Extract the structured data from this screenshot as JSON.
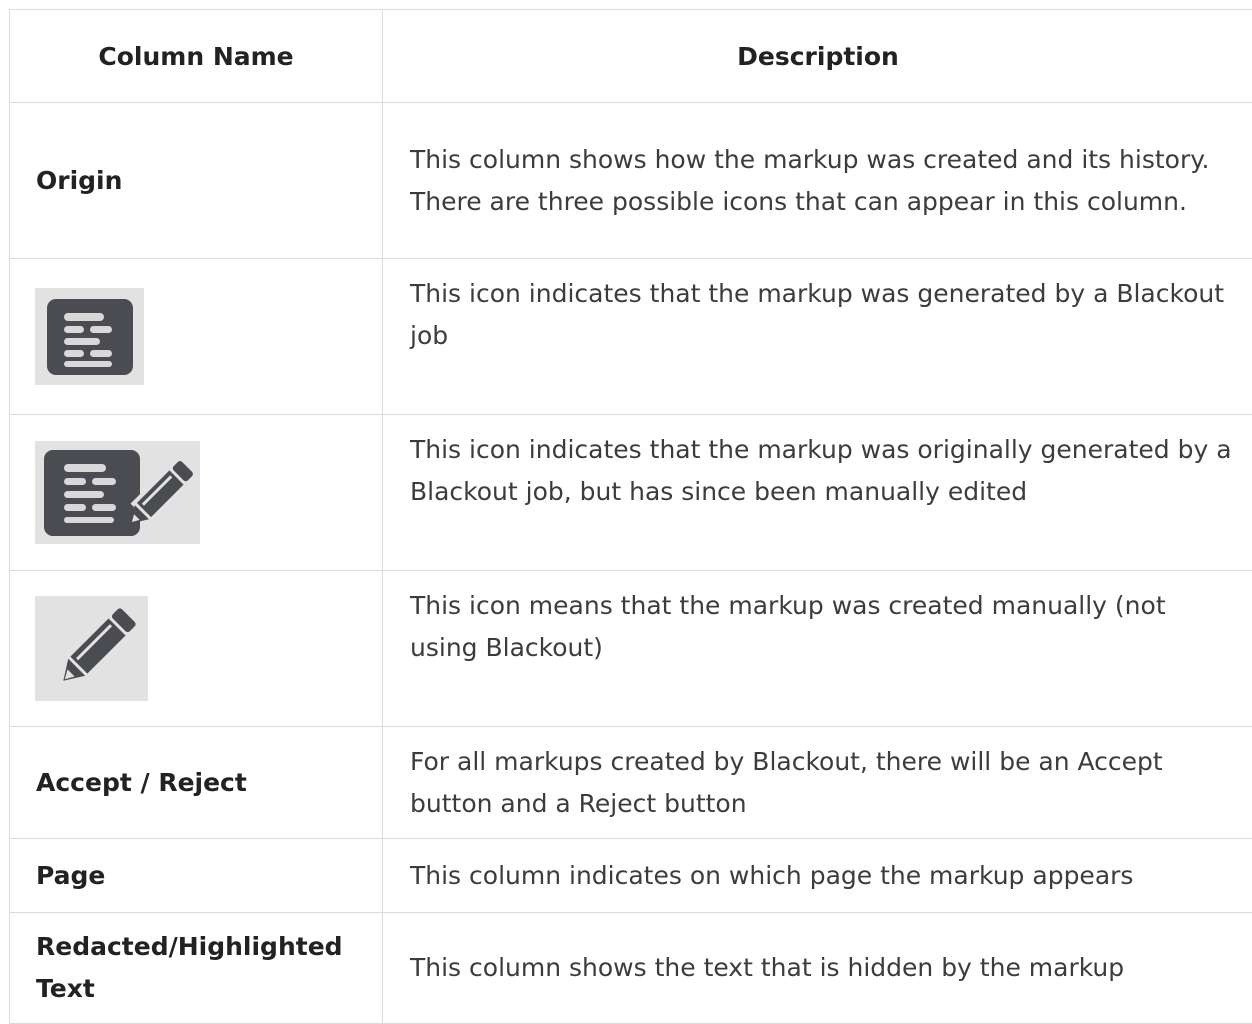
{
  "table": {
    "headers": [
      "Column Name",
      "Description"
    ],
    "rows": [
      {
        "name": "Origin",
        "icon": "",
        "description": "This column shows how the markup was created and its history. There are three possible icons that can appear in this column."
      },
      {
        "name": "",
        "icon": "blackout-job-icon",
        "description": "This icon indicates that the markup was generated by a Blackout job"
      },
      {
        "name": "",
        "icon": "blackout-edited-icon",
        "description": "This icon indicates that the markup was originally generated by a Blackout job, but has since been manually edited"
      },
      {
        "name": "",
        "icon": "pencil-icon",
        "description": "This icon means that the markup was created manually (not using Blackout)"
      },
      {
        "name": "Accept / Reject",
        "icon": "",
        "description": "For all markups created by Blackout, there will be an Accept button and a Reject button"
      },
      {
        "name": "Page",
        "icon": "",
        "description": "This column indicates on which page the markup appears"
      },
      {
        "name": "Redacted/Highlighted Text",
        "icon": "",
        "description": "This column shows the text that is hidden by the markup"
      }
    ]
  },
  "colors": {
    "icon_dark": "#4a4c52",
    "icon_bg": "#e2e2e2",
    "border": "#dcdcdc"
  }
}
